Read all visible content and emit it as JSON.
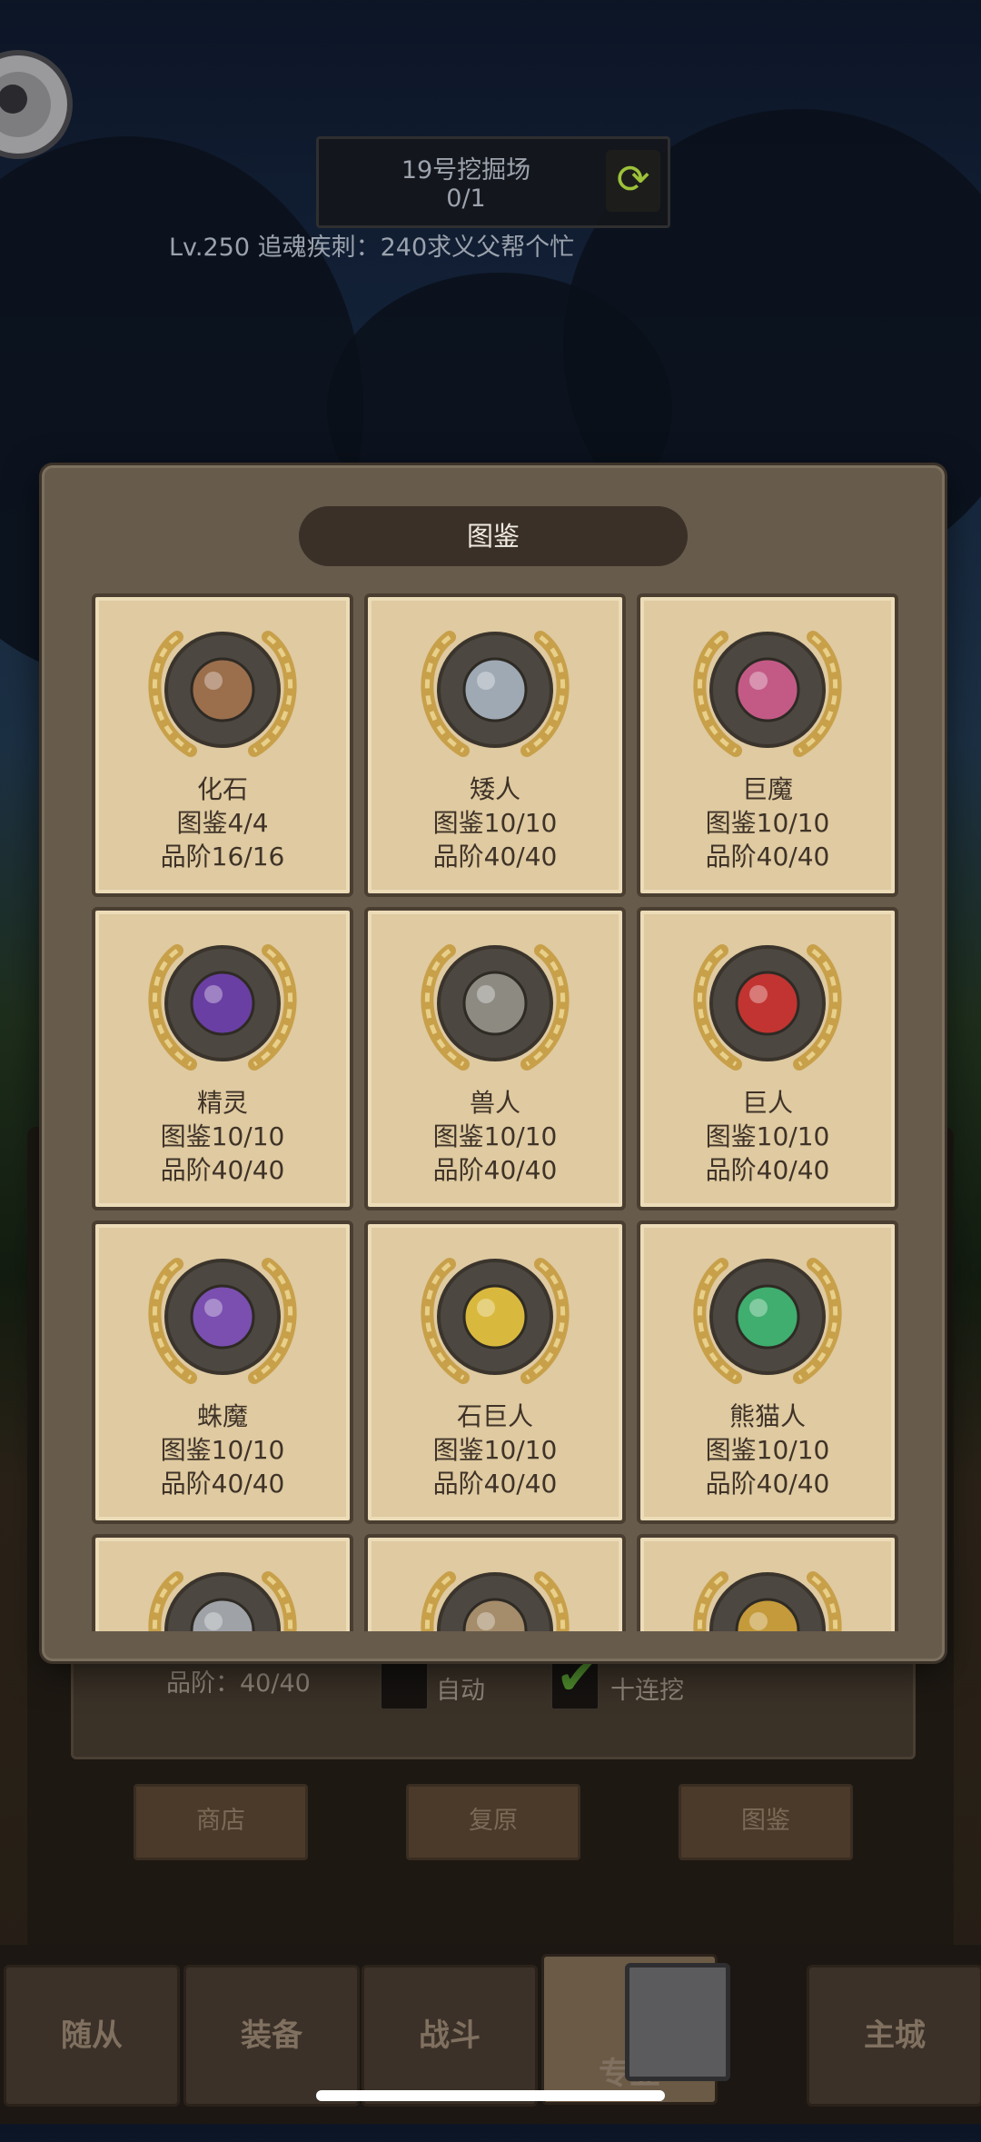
{
  "header": {
    "site_name": "19号挖掘场",
    "site_count": "0/1",
    "marquee": "Lv.250 追魂疾刺：240求义父帮个忙"
  },
  "modal": {
    "title": "图鉴",
    "cards": [
      {
        "name": "化石",
        "collection": "图鉴4/4",
        "grade": "品阶16/16",
        "icon": "fossil-stone-icon",
        "accent": "#9b6e4c"
      },
      {
        "name": "矮人",
        "collection": "图鉴10/10",
        "grade": "品阶40/40",
        "icon": "dwarf-hammer-icon",
        "accent": "#9fa9b4"
      },
      {
        "name": "巨魔",
        "collection": "图鉴10/10",
        "grade": "品阶40/40",
        "icon": "troll-crystal-icon",
        "accent": "#c35a86"
      },
      {
        "name": "精灵",
        "collection": "图鉴10/10",
        "grade": "品阶40/40",
        "icon": "elf-shuriken-icon",
        "accent": "#6a3fa3"
      },
      {
        "name": "兽人",
        "collection": "图鉴10/10",
        "grade": "品阶40/40",
        "icon": "orc-shield-icon",
        "accent": "#8d8a82"
      },
      {
        "name": "巨人",
        "collection": "图鉴10/10",
        "grade": "品阶40/40",
        "icon": "giant-bag-icon",
        "accent": "#c23431"
      },
      {
        "name": "蛛魔",
        "collection": "图鉴10/10",
        "grade": "品阶40/40",
        "icon": "spider-demon-icon",
        "accent": "#7a4fb0"
      },
      {
        "name": "石巨人",
        "collection": "图鉴10/10",
        "grade": "品阶40/40",
        "icon": "stone-giant-wings-icon",
        "accent": "#d9b93d"
      },
      {
        "name": "熊猫人",
        "collection": "图鉴10/10",
        "grade": "品阶40/40",
        "icon": "panda-jade-icon",
        "accent": "#3fae6e"
      },
      {
        "name": "",
        "collection": "",
        "grade": "",
        "icon": "partial-relic-icon",
        "accent": "#9fa3a8"
      },
      {
        "name": "",
        "collection": "",
        "grade": "",
        "icon": "partial-relic-icon",
        "accent": "#a58c6a"
      },
      {
        "name": "",
        "collection": "",
        "grade": "",
        "icon": "partial-sun-icon",
        "accent": "#c49a3a"
      }
    ]
  },
  "underlay": {
    "grade_text": "品阶：40/40",
    "auto_label": "自动",
    "ten_dig_label": "十连挖",
    "buttons": [
      "商店",
      "复原",
      "图鉴"
    ]
  },
  "nav": {
    "tabs": [
      "随从",
      "装备",
      "战斗",
      "专业",
      "主城"
    ]
  }
}
